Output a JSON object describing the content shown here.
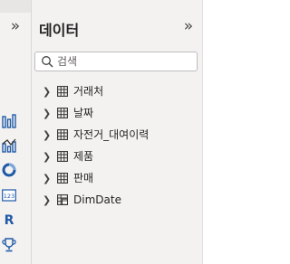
{
  "header": {
    "title": "데이터"
  },
  "search": {
    "placeholder": "검색"
  },
  "tables": [
    {
      "name": "거래처",
      "icon": "table-icon"
    },
    {
      "name": "날짜",
      "icon": "table-icon"
    },
    {
      "name": "자전거_대여이력",
      "icon": "table-icon"
    },
    {
      "name": "제품",
      "icon": "table-icon"
    },
    {
      "name": "판매",
      "icon": "table-icon"
    },
    {
      "name": "DimDate",
      "icon": "date-table-icon"
    }
  ],
  "visualizations": {
    "icons": [
      "column-chart-icon",
      "line-and-column-chart-icon",
      "donut-chart-icon",
      "card-icon",
      "r-visual-icon",
      "trophy-icon"
    ],
    "card_icon_text": "123",
    "r_visual_text": "R"
  },
  "colors": {
    "pane_bg": "#f3f2f1",
    "accent_blue": "#1f5aa6"
  }
}
